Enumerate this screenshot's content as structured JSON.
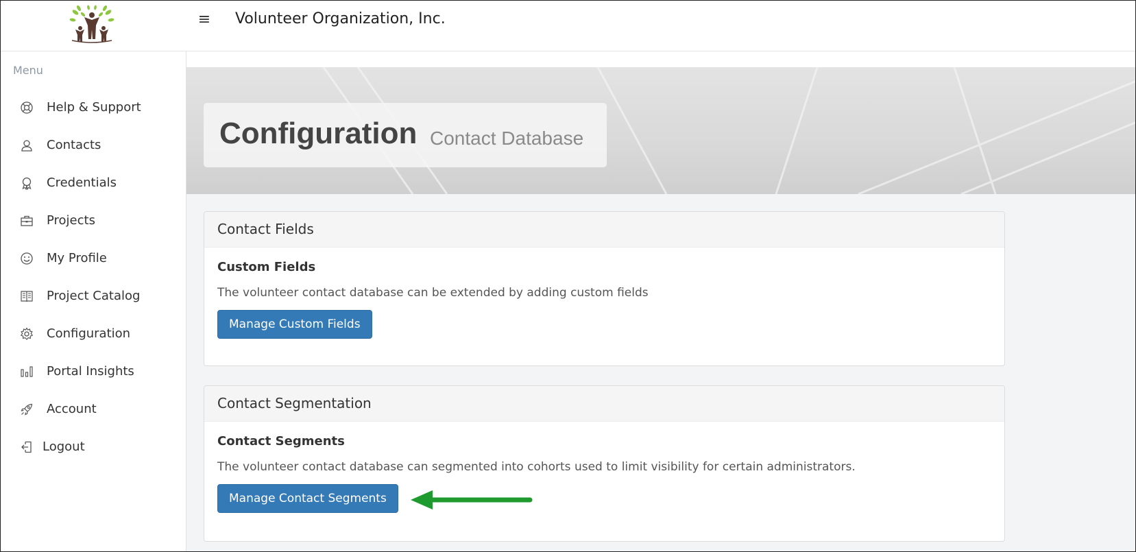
{
  "header": {
    "menu_toggle_icon": "≡",
    "org_name": "Volunteer Organization, Inc."
  },
  "sidebar": {
    "menu_label": "Menu",
    "items": [
      {
        "label": "Help & Support",
        "icon": "lifebuoy-icon"
      },
      {
        "label": "Contacts",
        "icon": "user-icon"
      },
      {
        "label": "Credentials",
        "icon": "badge-icon"
      },
      {
        "label": "Projects",
        "icon": "briefcase-icon"
      },
      {
        "label": "My Profile",
        "icon": "smiley-icon"
      },
      {
        "label": "Project Catalog",
        "icon": "book-icon"
      },
      {
        "label": "Configuration",
        "icon": "gear-icon"
      },
      {
        "label": "Portal Insights",
        "icon": "bar-chart-icon"
      },
      {
        "label": "Account",
        "icon": "rocket-icon"
      },
      {
        "label": "Logout",
        "icon": "logout-icon"
      }
    ]
  },
  "hero": {
    "title": "Configuration",
    "subtitle": "Contact Database"
  },
  "panels": [
    {
      "heading": "Contact Fields",
      "subheading": "Custom Fields",
      "description": "The volunteer contact database can be extended by adding custom fields",
      "button_label": "Manage Custom Fields"
    },
    {
      "heading": "Contact Segmentation",
      "subheading": "Contact Segments",
      "description": "The volunteer contact database can segmented into cohorts used to limit visibility for certain administrators.",
      "button_label": "Manage Contact Segments"
    }
  ],
  "colors": {
    "primary_button": "#337ab7",
    "annotation_arrow": "#1e9a2e",
    "sidebar_muted": "#8d98a3"
  }
}
